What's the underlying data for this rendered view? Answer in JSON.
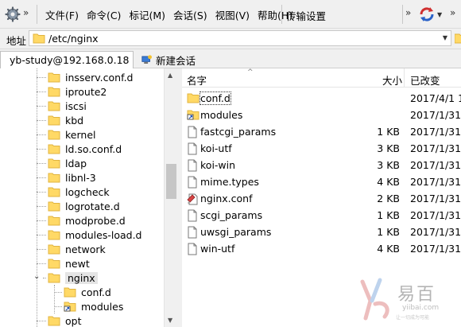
{
  "menubar": {
    "items": [
      "文件(F)",
      "命令(C)",
      "标记(M)",
      "会话(S)",
      "视图(V)",
      "帮助(H)"
    ],
    "transfer_settings": "传输设置"
  },
  "address": {
    "label": "地址",
    "path": "/etc/nginx"
  },
  "tabs": {
    "active": "yb-study@192.168.0.18",
    "new": "新建会话"
  },
  "tree": {
    "items": [
      {
        "label": "insserv.conf.d"
      },
      {
        "label": "iproute2"
      },
      {
        "label": "iscsi"
      },
      {
        "label": "kbd"
      },
      {
        "label": "kernel"
      },
      {
        "label": "ld.so.conf.d"
      },
      {
        "label": "ldap"
      },
      {
        "label": "libnl-3"
      },
      {
        "label": "logcheck"
      },
      {
        "label": "logrotate.d"
      },
      {
        "label": "modprobe.d"
      },
      {
        "label": "modules-load.d"
      },
      {
        "label": "network"
      },
      {
        "label": "newt"
      },
      {
        "label": "nginx"
      },
      {
        "label": "conf.d"
      },
      {
        "label": "modules"
      },
      {
        "label": "opt"
      }
    ]
  },
  "filelist": {
    "columns": {
      "name": "名字",
      "size": "大小",
      "modified": "已改变"
    },
    "rows": [
      {
        "name": "conf.d",
        "size": "",
        "modified": "2017/4/1 1",
        "icon": "folder-icon"
      },
      {
        "name": "modules",
        "size": "",
        "modified": "2017/1/31",
        "icon": "folder-link-icon"
      },
      {
        "name": "fastcgi_params",
        "size": "1 KB",
        "modified": "2017/1/31",
        "icon": "file-icon"
      },
      {
        "name": "koi-utf",
        "size": "3 KB",
        "modified": "2017/1/31",
        "icon": "file-icon"
      },
      {
        "name": "koi-win",
        "size": "3 KB",
        "modified": "2017/1/31",
        "icon": "file-icon"
      },
      {
        "name": "mime.types",
        "size": "4 KB",
        "modified": "2017/1/31",
        "icon": "file-icon"
      },
      {
        "name": "nginx.conf",
        "size": "2 KB",
        "modified": "2017/1/31",
        "icon": "config-file-icon"
      },
      {
        "name": "scgi_params",
        "size": "1 KB",
        "modified": "2017/1/31",
        "icon": "file-icon"
      },
      {
        "name": "uwsgi_params",
        "size": "1 KB",
        "modified": "2017/1/31",
        "icon": "file-icon"
      },
      {
        "name": "win-utf",
        "size": "4 KB",
        "modified": "2017/1/31",
        "icon": "file-icon"
      }
    ]
  },
  "watermark": {
    "name": "易百",
    "url": "yiibai.com",
    "slogan": "让一切成为可能"
  },
  "colors": {
    "folder": "#ffd966",
    "folder_edge": "#e0b440",
    "selection": "#e5e5e5"
  }
}
